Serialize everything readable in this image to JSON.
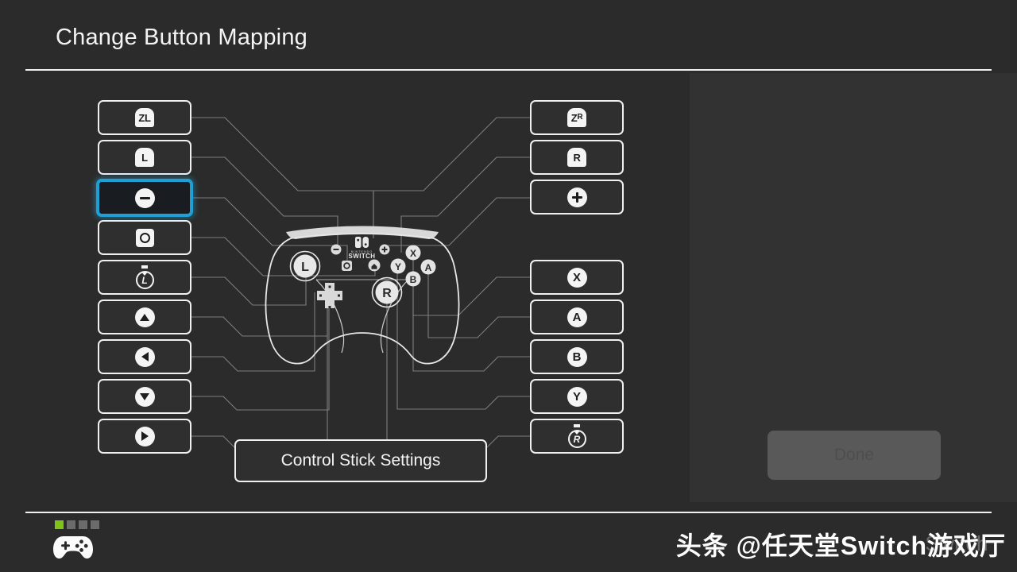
{
  "header": {
    "title": "Change Button Mapping"
  },
  "colors": {
    "background": "#2b2b2b",
    "panel": "#323232",
    "button_fill": "#2f2f2f",
    "button_border": "#f0f0f0",
    "selected_border": "#1f9fd4",
    "selected_fill": "#191c20",
    "done_fill": "#595959",
    "done_text": "#4e4e4e",
    "led_on": "#7fc318",
    "led_off": "#6b6b6b",
    "wire": "#8d8d8d"
  },
  "left_column": [
    {
      "id": "zl",
      "glyph": "trigger-zl-icon",
      "label": "ZL"
    },
    {
      "id": "l",
      "glyph": "trigger-l-icon",
      "label": "L"
    },
    {
      "id": "minus",
      "glyph": "minus-button-icon",
      "label": "-",
      "selected": true
    },
    {
      "id": "capture",
      "glyph": "capture-button-icon",
      "label": "Capture"
    },
    {
      "id": "lstick",
      "glyph": "left-stick-press-icon",
      "label": "L"
    },
    {
      "id": "dup",
      "glyph": "dpad-up-icon",
      "label": "Up"
    },
    {
      "id": "dleft",
      "glyph": "dpad-left-icon",
      "label": "Left"
    },
    {
      "id": "ddown",
      "glyph": "dpad-down-icon",
      "label": "Down"
    },
    {
      "id": "dright",
      "glyph": "dpad-right-icon",
      "label": "Right"
    }
  ],
  "right_column": [
    {
      "id": "zr",
      "glyph": "trigger-zr-icon",
      "label": "ZR"
    },
    {
      "id": "r",
      "glyph": "trigger-r-icon",
      "label": "R"
    },
    {
      "id": "plus",
      "glyph": "plus-button-icon",
      "label": "+"
    },
    {
      "id": "x",
      "glyph": "x-button-icon",
      "label": "X"
    },
    {
      "id": "a",
      "glyph": "a-button-icon",
      "label": "A"
    },
    {
      "id": "b",
      "glyph": "b-button-icon",
      "label": "B"
    },
    {
      "id": "y",
      "glyph": "y-button-icon",
      "label": "Y"
    },
    {
      "id": "rstick",
      "glyph": "right-stick-press-icon",
      "label": "R"
    }
  ],
  "controller": {
    "name": "nintendo-switch-pro-controller",
    "logo_top": "NINTENDO",
    "logo_bottom": "SWITCH",
    "left_stick_label": "L",
    "right_stick_label": "R",
    "face_buttons": [
      "X",
      "A",
      "B",
      "Y"
    ]
  },
  "stick_settings": {
    "label": "Control Stick Settings"
  },
  "done": {
    "label": "Done",
    "disabled": true
  },
  "footer": {
    "controller_icon": "gamepad-icon",
    "player_leds": [
      true,
      false,
      false,
      false
    ],
    "watermark": "头条 @任天堂Switch游戏厅",
    "watermark_ghost": "Switch"
  }
}
